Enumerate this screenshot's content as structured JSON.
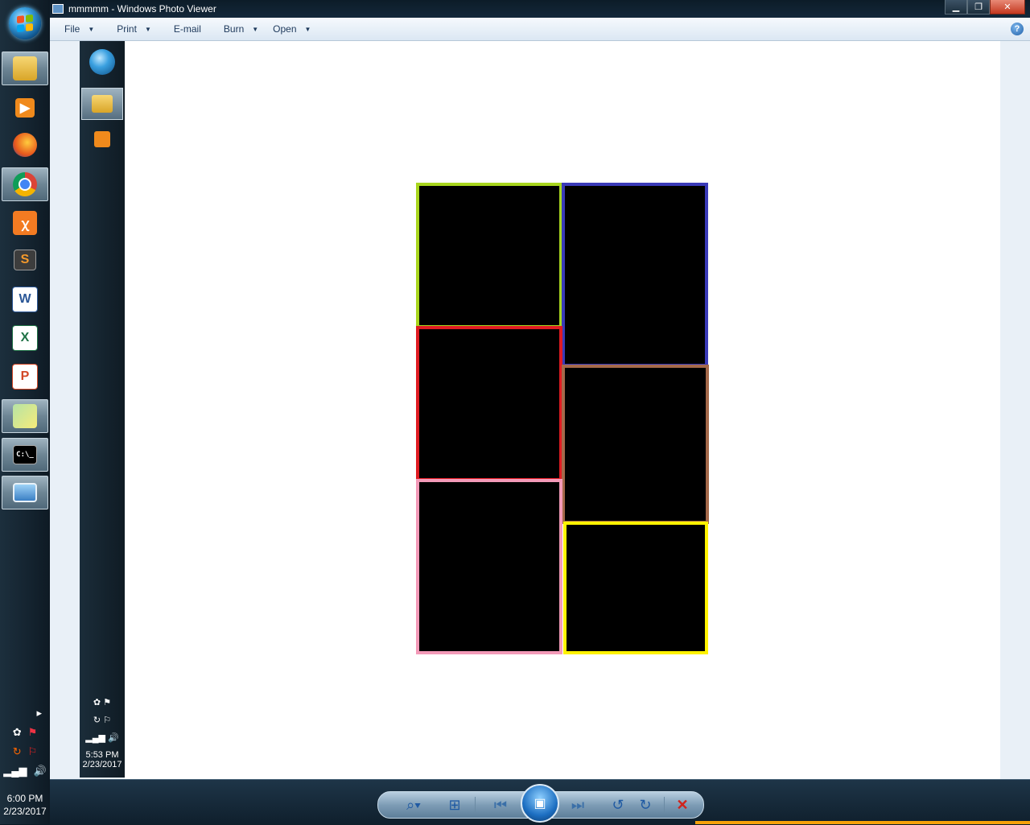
{
  "window": {
    "title": "mmmmm - Windows Photo Viewer"
  },
  "menubar": {
    "items": [
      {
        "label": "File"
      },
      {
        "label": "Print"
      },
      {
        "label": "E-mail"
      },
      {
        "label": "Burn"
      },
      {
        "label": "Open"
      }
    ],
    "help_label": "?"
  },
  "taskbar": {
    "apps": [
      "windows-explorer",
      "media-player",
      "firefox",
      "chrome",
      "xampp",
      "sublime-text",
      "word",
      "excel",
      "powerpoint",
      "sticky-notes",
      "command-prompt",
      "photo-viewer"
    ],
    "clock": {
      "time": "6:00 PM",
      "date": "2/23/2017"
    }
  },
  "nested_screenshot": {
    "clock": {
      "time": "5:53 PM",
      "date": "2/23/2017"
    }
  },
  "collage": {
    "background": "#000000",
    "boxes": [
      {
        "name": "green",
        "border_color": "#a8d61e"
      },
      {
        "name": "blue",
        "border_color": "#3a3ab8"
      },
      {
        "name": "red",
        "border_color": "#e01b22"
      },
      {
        "name": "brown",
        "border_color": "#a5694a"
      },
      {
        "name": "pink",
        "border_color": "#f39ab8"
      },
      {
        "name": "yellow",
        "border_color": "#fff200"
      }
    ]
  },
  "controls": {
    "zoom_icon": "magnifier-icon",
    "actual_size_icon": "fit-icon",
    "previous_icon": "previous-icon",
    "slideshow_icon": "slideshow-icon",
    "next_icon": "next-icon",
    "rotate_ccw_icon": "rotate-ccw-icon",
    "rotate_cw_icon": "rotate-cw-icon",
    "delete_icon": "delete-icon"
  }
}
